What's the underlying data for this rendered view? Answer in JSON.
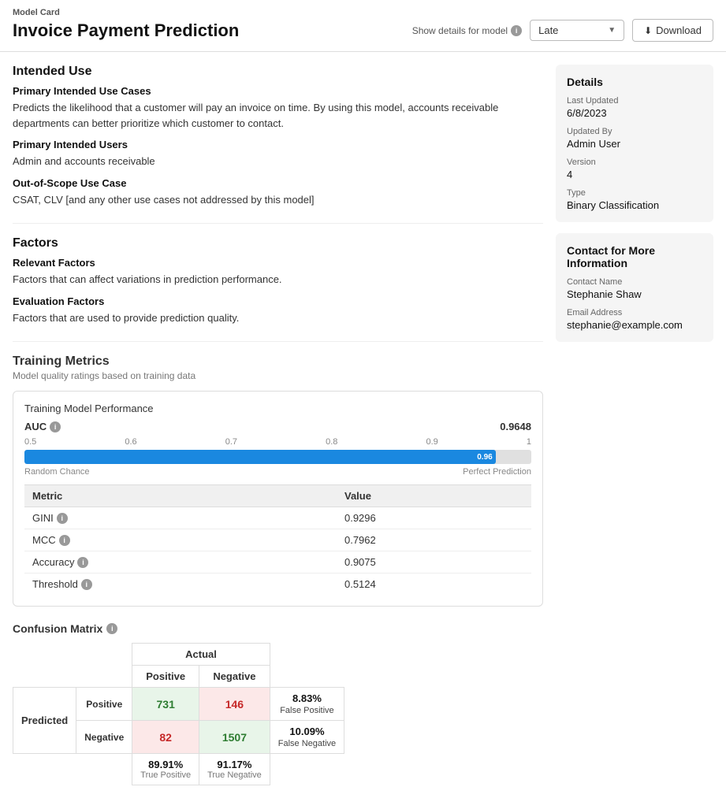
{
  "header": {
    "model_card_label": "Model Card",
    "title": "Invoice Payment Prediction",
    "show_details_label": "Show details for model",
    "model_selected": "Late",
    "download_btn": "Download"
  },
  "intended_use": {
    "section_title": "Intended Use",
    "primary_use_label": "Primary Intended Use Cases",
    "primary_use_text": "Predicts the likelihood that a customer will pay an invoice on time. By using this model, accounts receivable departments can better prioritize which customer to contact.",
    "users_label": "Primary Intended Users",
    "users_text": "Admin and accounts receivable",
    "out_of_scope_label": "Out-of-Scope Use Case",
    "out_of_scope_text": "CSAT, CLV [and any other use cases not addressed by this model]"
  },
  "factors": {
    "section_title": "Factors",
    "relevant_label": "Relevant Factors",
    "relevant_text": "Factors that can affect variations in prediction performance.",
    "evaluation_label": "Evaluation Factors",
    "evaluation_text": "Factors that are used to provide prediction quality."
  },
  "training_metrics": {
    "section_title": "Training Metrics",
    "subtitle": "Model quality ratings based on training data",
    "box_title": "Training Model Performance",
    "auc_label": "AUC",
    "auc_value": "0.9648",
    "gauge_fill_pct": 92.96,
    "gauge_label": "0.96",
    "scale": [
      "0.5",
      "0.6",
      "0.7",
      "0.8",
      "0.9",
      "1"
    ],
    "left_label": "Random Chance",
    "right_label": "Perfect Prediction",
    "metrics_col_metric": "Metric",
    "metrics_col_value": "Value",
    "metrics": [
      {
        "name": "GINI",
        "value": "0.9296"
      },
      {
        "name": "MCC",
        "value": "0.7962"
      },
      {
        "name": "Accuracy",
        "value": "0.9075"
      },
      {
        "name": "Threshold",
        "value": "0.5124"
      }
    ]
  },
  "confusion_matrix": {
    "title": "Confusion Matrix",
    "actual_label": "Actual",
    "predicted_label": "Predicted",
    "positive_label": "Positive",
    "negative_label": "Negative",
    "cells": {
      "tp": "731",
      "fp": "146",
      "fn": "82",
      "tn": "1507"
    },
    "side_labels": {
      "fp_pct": "8.83%",
      "fp_label": "False Positive",
      "fn_pct": "10.09%",
      "fn_label": "False Negative"
    },
    "bottom_labels": {
      "tp_pct": "89.91%",
      "tp_label": "True Positive",
      "tn_pct": "91.17%",
      "tn_label": "True Negative"
    }
  },
  "details": {
    "card_title": "Details",
    "last_updated_label": "Last Updated",
    "last_updated_value": "6/8/2023",
    "updated_by_label": "Updated By",
    "updated_by_value": "Admin User",
    "version_label": "Version",
    "version_value": "4",
    "type_label": "Type",
    "type_value": "Binary Classification"
  },
  "contact": {
    "card_title": "Contact for More Information",
    "name_label": "Contact Name",
    "name_value": "Stephanie Shaw",
    "email_label": "Email Address",
    "email_value": "stephanie@example.com"
  }
}
